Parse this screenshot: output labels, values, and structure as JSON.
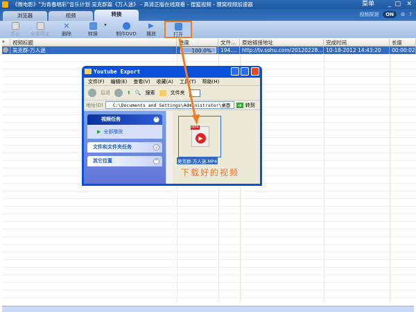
{
  "window": {
    "title": "《微电影》\"为青春唱彩\"音乐计划 吴克群篇《万人迷》 - 高清正版在线观看 - 搜狐视频 - 狸窝视频加速器",
    "menu": "菜单",
    "minimize": "_",
    "maximize": "□",
    "close": "✕"
  },
  "tabs": [
    {
      "label": "浏览器"
    },
    {
      "label": "视频"
    },
    {
      "label": "转换"
    }
  ],
  "controls": {
    "detect_label": "视频探测",
    "toggle": "ON",
    "settings": "⚙",
    "help": "?"
  },
  "toolbar": {
    "stop": "停止",
    "stop_all": "全部停止",
    "delete": "删除",
    "convert": "转换",
    "make_dvd": "制作DVD",
    "play": "播放",
    "open": "打开"
  },
  "table": {
    "headers": [
      "*",
      "视频标题",
      "进度",
      "文件...",
      "原始链接地址",
      "完成时间",
      "长度"
    ],
    "rows": [
      {
        "title": "吴克群-万人迷",
        "progress": "100.0%",
        "size": "194....",
        "url": "http://tv.sohu.com/20120228/...",
        "time": "10-18-2012 14:43:20",
        "length": "00:00:02"
      }
    ]
  },
  "dialog": {
    "title": "Youtube Export",
    "menu": [
      "文件(F)",
      "编辑(E)",
      "查看(V)",
      "收藏(A)",
      "工具(T)",
      "帮助(H)"
    ],
    "back": "后退",
    "search": "搜索",
    "folders": "文件夹",
    "address_label": "地址(D)",
    "address": "C:\\Documents and Settings\\Administrator\\桌面",
    "go": "转到",
    "video_tasks": "视频任务",
    "play_all": "全部播放",
    "file_tasks": "文件和文件夹任务",
    "other_places": "其它位置",
    "file_name": "吴克群-万人迷.MP4",
    "file_badge": "MP4"
  },
  "annotation": "下载好的视频",
  "colors": {
    "accent": "#f07c22",
    "selection": "#316ac5"
  }
}
